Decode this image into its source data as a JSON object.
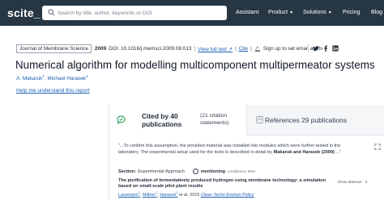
{
  "nav": {
    "logo": "scite_",
    "search_placeholder": "Search by title, author, keywords or DOI",
    "assistant": "Assistant",
    "product": "Product",
    "solutions": "Solutions",
    "pricing": "Pricing",
    "blog": "Blog"
  },
  "meta": {
    "journal": "Journal of Membrane Science",
    "year": "2009",
    "doi": "DOI: 10.1016/j.memsci.2009.08.013",
    "view_full_text": "View full text",
    "cite": "Cite",
    "sign_up": "Sign up to set email alerts"
  },
  "paper": {
    "title": "Numerical algorithm for modelling multicomponent multipermeator systems",
    "authors": [
      {
        "name": "A. Makaruk",
        "sup": "1"
      },
      {
        "name": "Michael Harasek",
        "sup": "1"
      }
    ],
    "help_link": "Help me understand this report"
  },
  "tabs": {
    "cited_by": "Cited by 40 publications",
    "citation_statements": "(21 citation statements)",
    "references": "References 29 publications"
  },
  "citation": {
    "snippet_text": "\"...To confirm this assumption, the provided material was installed into modules which were further tested in the laboratory. The experimental setup used for the tests is described in detail by ",
    "snippet_bold": "Makaruk and Harasek (2009)",
    "snippet_end": " ...\"",
    "section_label": "Section:",
    "section_value": "Experimental Approach",
    "type": "mentioning",
    "confidence": "confidence: 99%",
    "title": "The purification of fermentatively produced hydrogen using membrane technology: a simulation based on small-scale pilot plant results",
    "authors": [
      {
        "name": "Lassmann",
        "sup": "1"
      },
      {
        "name": "Miltner",
        "sup": "1"
      },
      {
        "name": "Harasek",
        "sup": "1"
      }
    ],
    "et_al_year": "et al. 2015",
    "journal": "Clean Techn Environ Policy",
    "show_abstract": "show abstract"
  },
  "colors": {
    "nav_bg": "#263743",
    "link": "#1a5fb4",
    "tab_inactive_bg": "#f4f6f8",
    "mentioning": "#374151"
  },
  "icons": [
    "search-icon",
    "chevron-down-icon",
    "bell-icon",
    "twitter-icon",
    "facebook-icon",
    "linkedin-icon",
    "speech-bubble-icon",
    "book-icon",
    "expand-icon"
  ]
}
